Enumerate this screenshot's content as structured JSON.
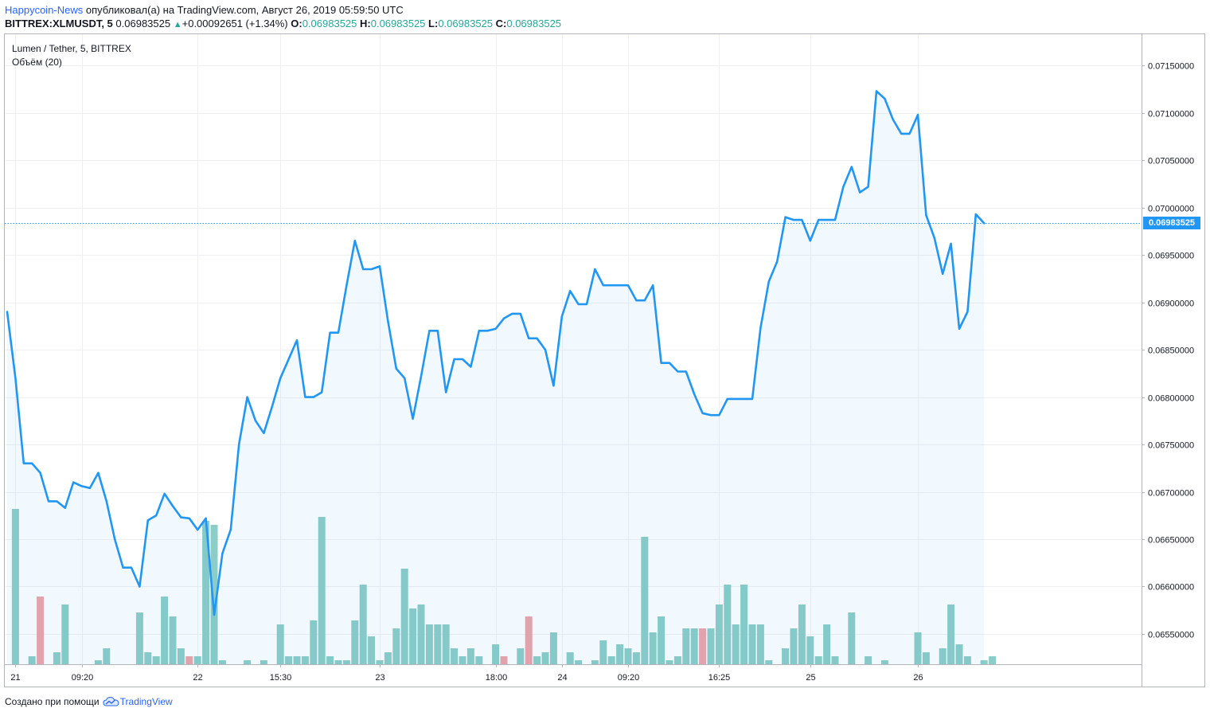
{
  "header": {
    "author": "Happycoin-News",
    "published_text": " опубликовал(а) на TradingView.com, Август 26, 2019 05:59:50 UTC",
    "symbol": "BITTREX:XLMUSDT, 5",
    "last_price": "0.06983525",
    "change_text": "+0.00092651 (+1.34%)",
    "o_label": "O:",
    "o_value": "0.06983525",
    "h_label": "H:",
    "h_value": "0.06983525",
    "l_label": "L:",
    "l_value": "0.06983525",
    "c_label": "C:",
    "c_value": "0.06983525"
  },
  "legend": {
    "series_title": "Lumen / Tether, 5, BITTREX",
    "volume_title": "Объём (20)"
  },
  "price_tag": "0.06983525",
  "footer": {
    "created_with": "Создано при помощи",
    "brand": "TradingView"
  },
  "colors": {
    "line": "#2196f3",
    "area_fill": "#2196f3",
    "volume_up": "#8dcdc7",
    "volume_down": "#eea3a7",
    "grid": "#eef0f4",
    "axis_border": "#b2b5be"
  },
  "chart_data": {
    "type": "line",
    "ylim": [
      0.06518,
      0.07183
    ],
    "yticks": [
      "0.06550000",
      "0.06600000",
      "0.06650000",
      "0.06700000",
      "0.06750000",
      "0.06800000",
      "0.06850000",
      "0.06900000",
      "0.06950000",
      "0.07000000",
      "0.07050000",
      "0.07100000",
      "0.07150000"
    ],
    "ytick_values": [
      0.0655,
      0.066,
      0.0665,
      0.067,
      0.0675,
      0.068,
      0.0685,
      0.069,
      0.0695,
      0.07,
      0.0705,
      0.071,
      0.0715
    ],
    "xtick_labels": [
      "21",
      "09:20",
      "22",
      "15:30",
      "23",
      "18:00",
      "24",
      "09:20",
      "16:25",
      "25",
      "26"
    ],
    "xtick_index": [
      1,
      9,
      23,
      33,
      45,
      59,
      67,
      75,
      86,
      97,
      110
    ],
    "current_price": 0.06983525,
    "price": [
      0.0689,
      0.0682,
      0.0673,
      0.0673,
      0.0672,
      0.0669,
      0.0669,
      0.06683,
      0.0671,
      0.06706,
      0.06704,
      0.0672,
      0.0669,
      0.0665,
      0.0662,
      0.0662,
      0.066,
      0.0667,
      0.06675,
      0.06698,
      0.06685,
      0.06673,
      0.06672,
      0.0666,
      0.06672,
      0.0657,
      0.06635,
      0.0666,
      0.0675,
      0.068,
      0.06775,
      0.06762,
      0.0679,
      0.0682,
      0.0684,
      0.0686,
      0.068,
      0.068,
      0.06805,
      0.06868,
      0.06868,
      0.06918,
      0.06965,
      0.06935,
      0.06935,
      0.06938,
      0.0688,
      0.0683,
      0.0682,
      0.06777,
      0.06822,
      0.0687,
      0.0687,
      0.06805,
      0.0684,
      0.0684,
      0.06832,
      0.0687,
      0.0687,
      0.06872,
      0.06883,
      0.06888,
      0.06888,
      0.06862,
      0.06862,
      0.0685,
      0.06812,
      0.06885,
      0.06912,
      0.06898,
      0.06898,
      0.06935,
      0.06918,
      0.06918,
      0.06918,
      0.06918,
      0.06902,
      0.06902,
      0.06918,
      0.06836,
      0.06836,
      0.06827,
      0.06827,
      0.06803,
      0.06783,
      0.06781,
      0.06781,
      0.06798,
      0.06798,
      0.06798,
      0.06798,
      0.06873,
      0.06922,
      0.06943,
      0.0699,
      0.06987,
      0.06987,
      0.06965,
      0.06987,
      0.06987,
      0.06987,
      0.07022,
      0.07043,
      0.07016,
      0.07022,
      0.07123,
      0.07115,
      0.07093,
      0.07078,
      0.07078,
      0.07098,
      0.06992,
      0.06968,
      0.0693,
      0.06962,
      0.06872,
      0.0689,
      0.06993,
      0.06983525
    ],
    "volume_ticks": [
      0,
      39,
      0,
      2,
      17,
      0,
      3,
      15,
      0,
      0,
      0,
      1,
      4,
      0,
      0,
      0,
      13,
      3,
      2,
      17,
      12,
      4,
      2,
      2,
      36,
      35,
      1,
      0,
      0,
      1,
      0,
      1,
      0,
      10,
      2,
      2,
      2,
      11,
      37,
      2,
      1,
      1,
      11,
      20,
      7,
      1,
      3,
      9,
      24,
      14,
      15,
      10,
      10,
      10,
      4,
      2,
      4,
      2,
      0,
      5,
      2,
      0,
      4,
      12,
      2,
      3,
      8,
      0,
      3,
      1,
      0,
      1,
      6,
      2,
      5,
      4,
      3,
      32,
      8,
      12,
      1,
      2,
      9,
      9,
      9,
      9,
      15,
      20,
      10,
      20,
      10,
      10,
      1,
      0,
      4,
      9,
      15,
      7,
      2,
      10,
      2,
      0,
      13,
      0,
      2,
      0,
      1,
      0,
      0,
      0,
      8,
      3,
      0,
      4,
      15,
      5,
      2,
      0,
      1,
      2
    ],
    "volume_direction": [
      "u",
      "u",
      "u",
      "u",
      "d",
      "u",
      "u",
      "u",
      "u",
      "u",
      "u",
      "u",
      "u",
      "d",
      "u",
      "u",
      "u",
      "u",
      "u",
      "u",
      "u",
      "u",
      "d",
      "u",
      "u",
      "u",
      "u",
      "u",
      "u",
      "u",
      "u",
      "u",
      "u",
      "u",
      "u",
      "u",
      "u",
      "u",
      "u",
      "u",
      "u",
      "u",
      "u",
      "u",
      "u",
      "u",
      "u",
      "u",
      "u",
      "u",
      "u",
      "u",
      "u",
      "u",
      "u",
      "u",
      "u",
      "u",
      "u",
      "u",
      "d",
      "u",
      "u",
      "d",
      "u",
      "u",
      "u",
      "u",
      "u",
      "u",
      "d",
      "u",
      "u",
      "u",
      "u",
      "u",
      "u",
      "u",
      "u",
      "u",
      "u",
      "u",
      "u",
      "u",
      "d",
      "u",
      "u",
      "u",
      "u",
      "u",
      "u",
      "u",
      "u",
      "u",
      "u",
      "u",
      "u",
      "u",
      "u",
      "u",
      "u",
      "u",
      "u",
      "u",
      "u",
      "u",
      "u",
      "u",
      "u",
      "u",
      "u",
      "u",
      "u",
      "u",
      "u",
      "u",
      "u",
      "u",
      "u",
      "u"
    ]
  }
}
